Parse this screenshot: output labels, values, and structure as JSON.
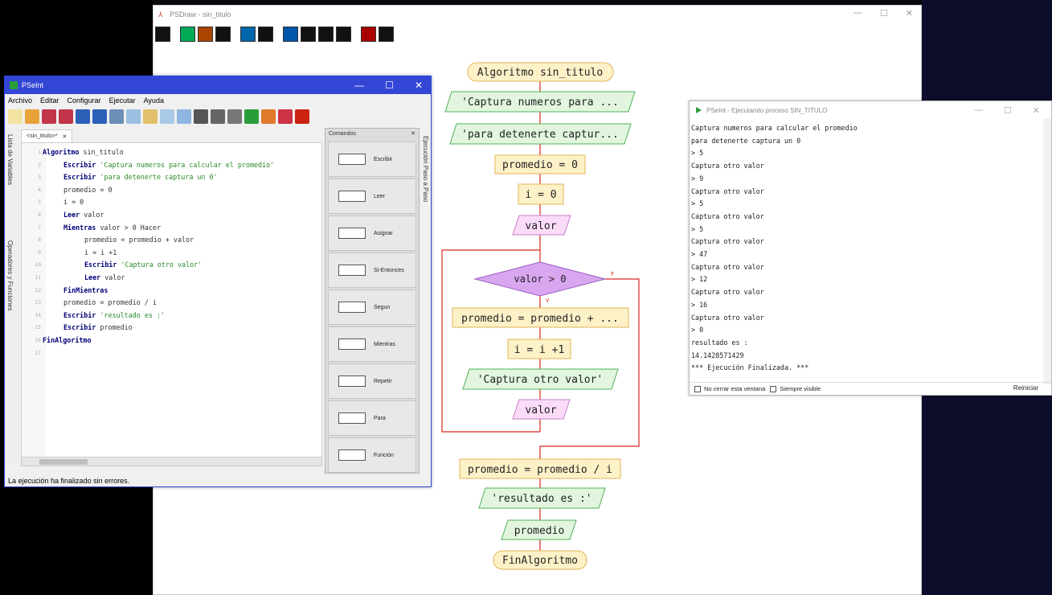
{
  "psdraw": {
    "title": "PSDraw - sin_titulo"
  },
  "flowchart": {
    "start": "Algoritmo sin_titulo",
    "out1": "'Captura numeros para ...",
    "out2": "'para detenerte captur...",
    "assign1": "promedio = 0",
    "assign2": "i = 0",
    "read1": "valor",
    "cond": "valor > 0",
    "cond_true": "V",
    "cond_false": "F",
    "assign3": "promedio = promedio + ...",
    "assign4": "i = i +1",
    "out3": "'Captura otro valor'",
    "read2": "valor",
    "assign5": "promedio = promedio / i",
    "out4": "'resultado es :'",
    "out5": "promedio",
    "end": "FinAlgoritmo"
  },
  "pseint": {
    "title": "PSeInt",
    "menu": [
      "Archivo",
      "Editar",
      "Configurar",
      "Ejecutar",
      "Ayuda"
    ],
    "doc_tab": "<sin_titulo>*",
    "side_tabs": [
      "Lista de Variables",
      "Operadores y Funciones"
    ],
    "exec_tab": "Ejecución Paso a Paso",
    "status": "La ejecución ha finalizado sin errores.",
    "comandos_title": "Comandos",
    "comandos": [
      "Escribir",
      "Leer",
      "Asignar",
      "Si-Entonces",
      "Segun",
      "Mientras",
      "Repetir",
      "Para",
      "Función"
    ],
    "code": [
      {
        "n": "1",
        "kw": "Algoritmo",
        "rest": " sin_titulo"
      },
      {
        "n": "2",
        "kw": "Escribir",
        "rest": " 'Captura numeros para calcular el promedio'"
      },
      {
        "n": "3",
        "kw": "Escribir",
        "rest": " 'para detenerte captura un 0'"
      },
      {
        "n": "4",
        "kw": "",
        "rest": "promedio = 0"
      },
      {
        "n": "5",
        "kw": "",
        "rest": "i = 0"
      },
      {
        "n": "6",
        "kw": "Leer",
        "rest": " valor"
      },
      {
        "n": "7",
        "kw": "Mientras",
        "rest": " valor > 0 Hacer"
      },
      {
        "n": "8",
        "kw": "",
        "rest": "promedio = promedio + valor"
      },
      {
        "n": "9",
        "kw": "",
        "rest": "i = i +1"
      },
      {
        "n": "10",
        "kw": "Escribir",
        "rest": " 'Captura otro valor'"
      },
      {
        "n": "11",
        "kw": "Leer",
        "rest": " valor"
      },
      {
        "n": "12",
        "kw": "FinMientras",
        "rest": ""
      },
      {
        "n": "13",
        "kw": "",
        "rest": "promedio = promedio / i"
      },
      {
        "n": "14",
        "kw": "Escribir",
        "rest": " 'resultado es :'"
      },
      {
        "n": "15",
        "kw": "Escribir",
        "rest": " promedio"
      },
      {
        "n": "16",
        "kw": "FinAlgoritmo",
        "rest": ""
      },
      {
        "n": "17",
        "kw": "",
        "rest": ""
      }
    ]
  },
  "console": {
    "title": "PSeInt - Ejecutando proceso SIN_TITULO",
    "lines": [
      "Captura numeros para calcular el promedio",
      "para detenerte captura un 0",
      "> 5",
      "Captura otro valor",
      "> 9",
      "Captura otro valor",
      "> 5",
      "Captura otro valor",
      "> 5",
      "Captura otro valor",
      "> 47",
      "Captura otro valor",
      "> 12",
      "Captura otro valor",
      "> 16",
      "Captura otro valor",
      "> 0",
      "resultado es :",
      "14.1428571429",
      "*** Ejecución Finalizada. ***"
    ],
    "no_cerrar": "No cerrar esta ventana",
    "siempre_visible": "Siempre visible",
    "reiniciar": "Reiniciar"
  }
}
